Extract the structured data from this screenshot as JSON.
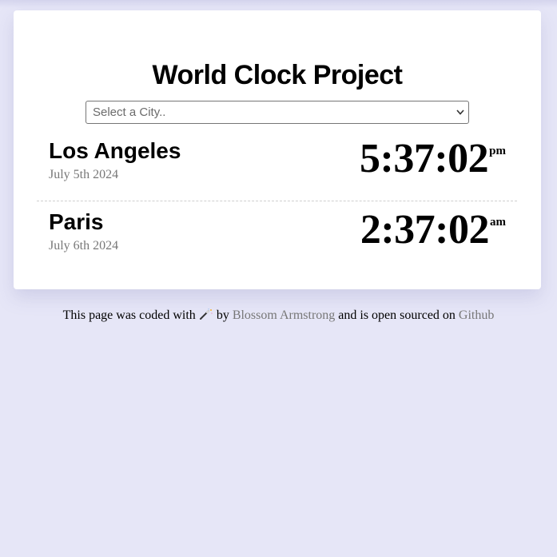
{
  "title": "World Clock Project",
  "city_select": {
    "placeholder": "Select a City.."
  },
  "cities": [
    {
      "name": "Los Angeles",
      "date": "July 5th 2024",
      "time": "5:37:02",
      "ampm": "pm"
    },
    {
      "name": "Paris",
      "date": "July 6th 2024",
      "time": "2:37:02",
      "ampm": "am"
    }
  ],
  "footer": {
    "text_before_icon": "This page was coded with",
    "icon": "magic-wand-icon",
    "text_by": "by",
    "author": "Blossom Armstrong",
    "text_middle": "and is open sourced on",
    "repo_link": "Github"
  },
  "colors": {
    "background": "#e6e6f7",
    "card": "#ffffff",
    "link": "#777777"
  }
}
